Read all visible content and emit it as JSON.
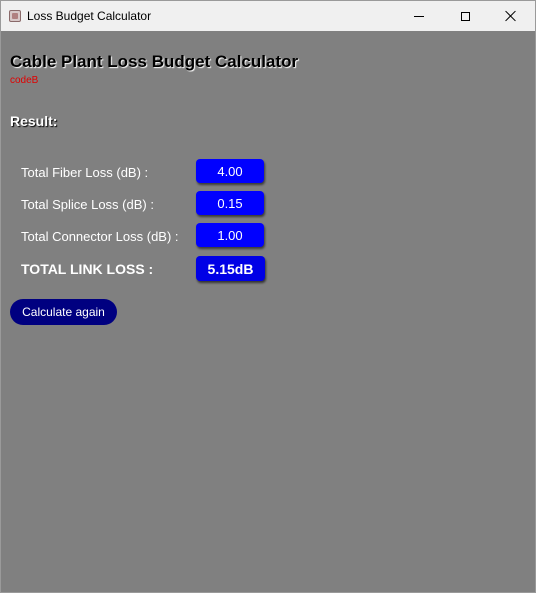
{
  "window": {
    "title": "Loss Budget Calculator",
    "icon": "app-icon",
    "controls": [
      "minimize-icon",
      "maximize-icon",
      "close-icon"
    ]
  },
  "header": {
    "title": "Cable Plant Loss Budget Calculator",
    "subtitle": "codeB",
    "subtitle_color": "#e00000"
  },
  "result": {
    "heading": "Result:",
    "rows": [
      {
        "label": "Total Fiber Loss (dB) :",
        "value": "4.00"
      },
      {
        "label": "Total Splice Loss (dB) :",
        "value": "0.15"
      },
      {
        "label": "Total Connector Loss (dB) :",
        "value": "1.00"
      }
    ],
    "total": {
      "label": "TOTAL LINK LOSS :",
      "value": "5.15dB"
    },
    "value_box_color": "#0000ff"
  },
  "actions": {
    "recalc_label": "Calculate again",
    "recalc_color": "#000080"
  },
  "background_color": "#808080"
}
